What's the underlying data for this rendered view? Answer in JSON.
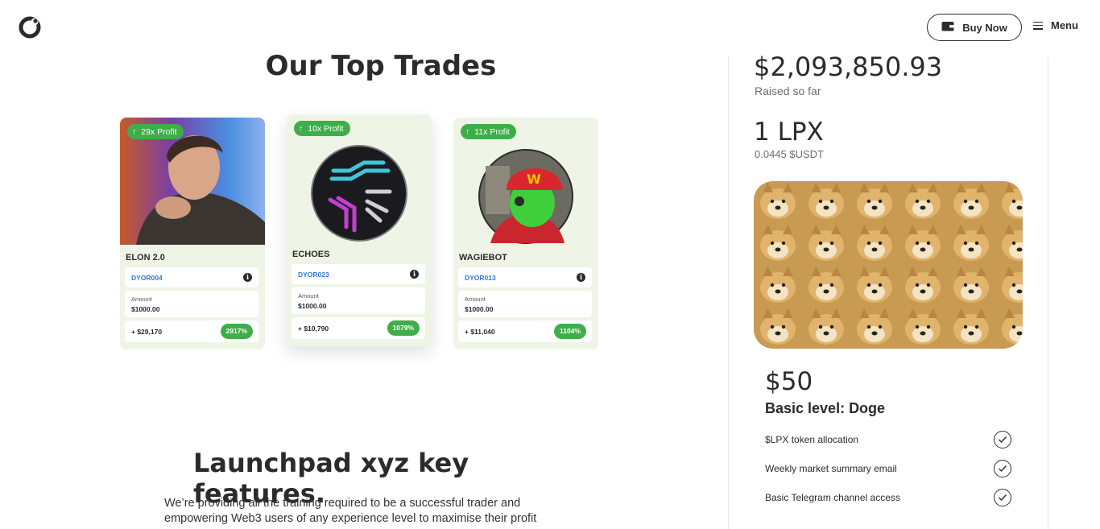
{
  "header": {
    "buy_label": "Buy Now",
    "menu_label": "Menu"
  },
  "top_trades": {
    "title": "Our Top Trades",
    "cards": [
      {
        "profit": "29x Profit",
        "name": "ELON 2.0",
        "code": "DYOR004",
        "amount_label": "Amount",
        "amount": "$1000.00",
        "gain": "+ $29,170",
        "pct": "2917%"
      },
      {
        "profit": "10x Profit",
        "name": "ECHOES",
        "code": "DYOR023",
        "amount_label": "Amount",
        "amount": "$1000.00",
        "gain": "+ $10,790",
        "pct": "1079%"
      },
      {
        "profit": "11x Profit",
        "name": "WAGIEBOT",
        "code": "DYOR013",
        "amount_label": "Amount",
        "amount": "$1000.00",
        "gain": "+ $11,040",
        "pct": "1104%"
      }
    ]
  },
  "features": {
    "title": "Launchpad xyz key features.",
    "description": "We’re providing all the training required to be a successful trader and empowering Web3 users of any experience level to maximise their profit"
  },
  "sidebar": {
    "raised_amount": "$2,093,850.93",
    "raised_label": "Raised so far",
    "token_price": "1 LPX",
    "token_price_usdt": "0.0445 $USDT",
    "tier_price": "$50",
    "tier_name": "Basic level: Doge",
    "tier_features": [
      "$LPX token allocation",
      "Weekly market summary email",
      "Basic Telegram channel access"
    ]
  },
  "colors": {
    "accent_green": "#3fae4a",
    "card_bg": "#eef5e6",
    "code_blue": "#2f7ad8"
  }
}
